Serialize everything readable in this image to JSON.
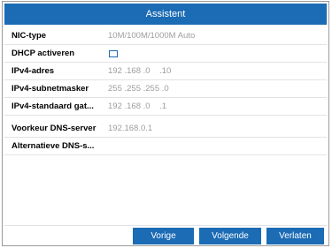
{
  "dialog": {
    "title": "Assistent"
  },
  "fields": [
    {
      "label": "NIC-type",
      "value": "10M/100M/1000M Auto"
    },
    {
      "label": "DHCP activeren",
      "checked": false
    },
    {
      "label": "IPv4-adres",
      "value": "192 .168 .0    .10"
    },
    {
      "label": "IPv4-subnetmasker",
      "value": "255 .255 .255 .0"
    },
    {
      "label": "IPv4-standaard gat...",
      "value": "192 .168 .0    .1"
    },
    {
      "label": "Voorkeur DNS-server",
      "value": "192.168.0.1"
    },
    {
      "label": "Alternatieve DNS-s...",
      "value": ""
    }
  ],
  "buttons": {
    "prev": "Vorige",
    "next": "Volgende",
    "exit": "Verlaten"
  },
  "colors": {
    "accent": "#1b6bb5",
    "value_text": "#9d9d9d"
  }
}
